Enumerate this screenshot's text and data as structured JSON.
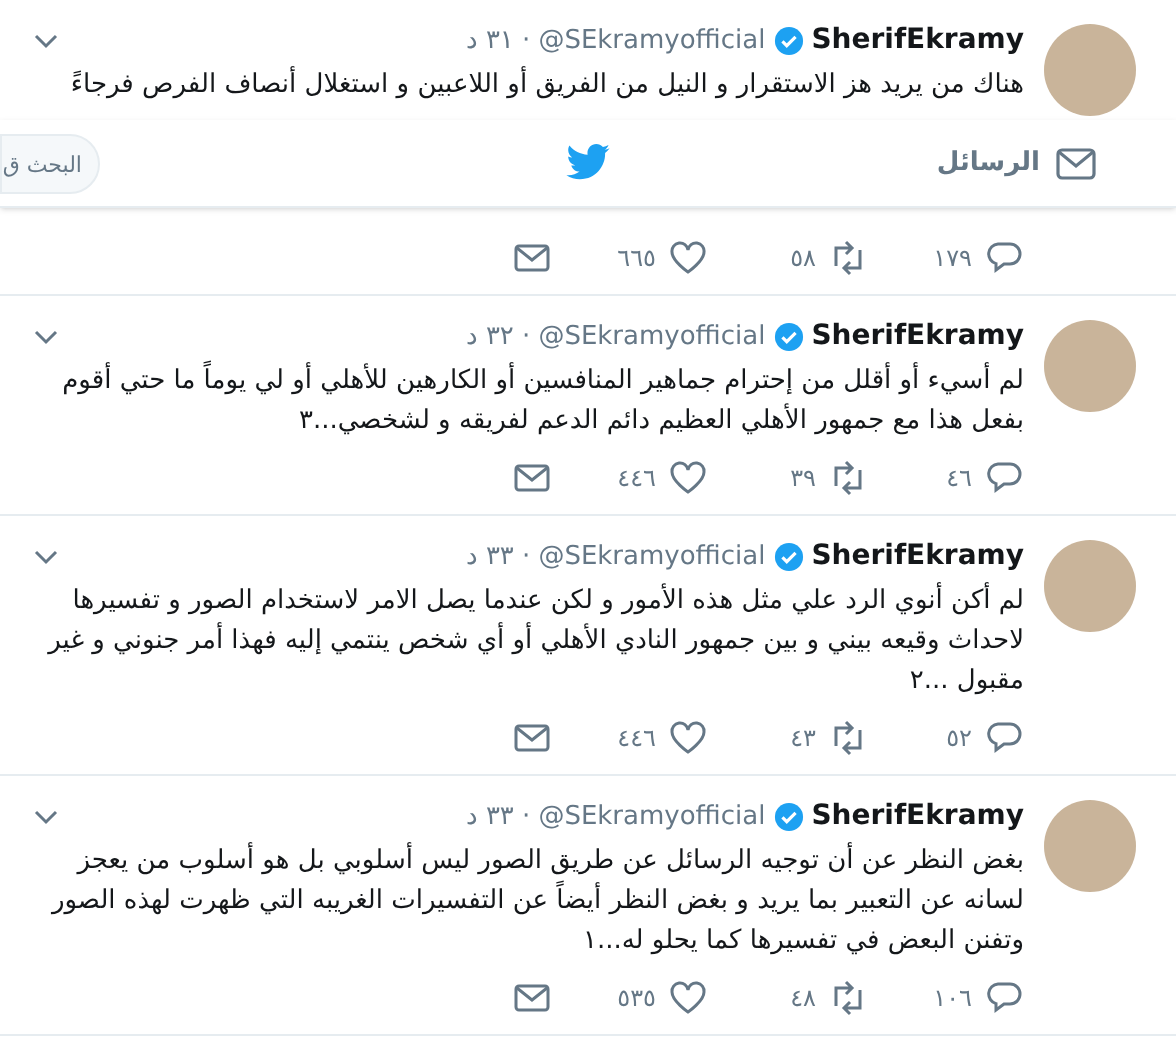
{
  "nav": {
    "messages_label": "الرسائل",
    "search": {
      "placeholder": "البحث ق"
    }
  },
  "tweets": [
    {
      "name": "SherifEkramy",
      "verified": true,
      "handle": "@SEkramyofficial",
      "time": "· ٣١ د",
      "text": "هناك من يريد هز الاستقرار و النيل من الفريق أو اللاعبين و استغلال أنصاف الفرص فرجاءً",
      "replies": "١٧٩",
      "retweets": "٥٨",
      "likes": "٦٦٥"
    },
    {
      "name": "SherifEkramy",
      "verified": true,
      "handle": "@SEkramyofficial",
      "time": "· ٣٢ د",
      "text": "لم أسيء أو أقلل من إحترام جماهير المنافسين أو الكارهين للأهلي أو لي يوماً ما حتي أقوم بفعل هذا مع جمهور الأهلي العظيم دائم الدعم لفريقه و لشخصي...٣",
      "replies": "٤٦",
      "retweets": "٣٩",
      "likes": "٤٤٦"
    },
    {
      "name": "SherifEkramy",
      "verified": true,
      "handle": "@SEkramyofficial",
      "time": "· ٣٣ د",
      "text": "لم أكن أنوي الرد علي مثل هذه الأمور و لكن عندما يصل الامر لاستخدام الصور و تفسيرها لاحداث وقيعه بيني و بين جمهور النادي الأهلي أو أي شخص ينتمي إليه فهذا أمر جنوني و غير مقبول ...٢",
      "replies": "٥٢",
      "retweets": "٤٣",
      "likes": "٤٤٦"
    },
    {
      "name": "SherifEkramy",
      "verified": true,
      "handle": "@SEkramyofficial",
      "time": "· ٣٣ د",
      "text": "بغض النظر عن أن توجيه الرسائل عن طريق الصور ليس أسلوبي بل هو أسلوب من يعجز لسانه عن التعبير بما يريد و بغض النظر أيضاً عن التفسيرات الغريبه التي ظهرت لهذه الصور وتفنن البعض في تفسيرها كما يحلو له...١",
      "replies": "١٠٦",
      "retweets": "٤٨",
      "likes": "٥٣٥"
    }
  ]
}
